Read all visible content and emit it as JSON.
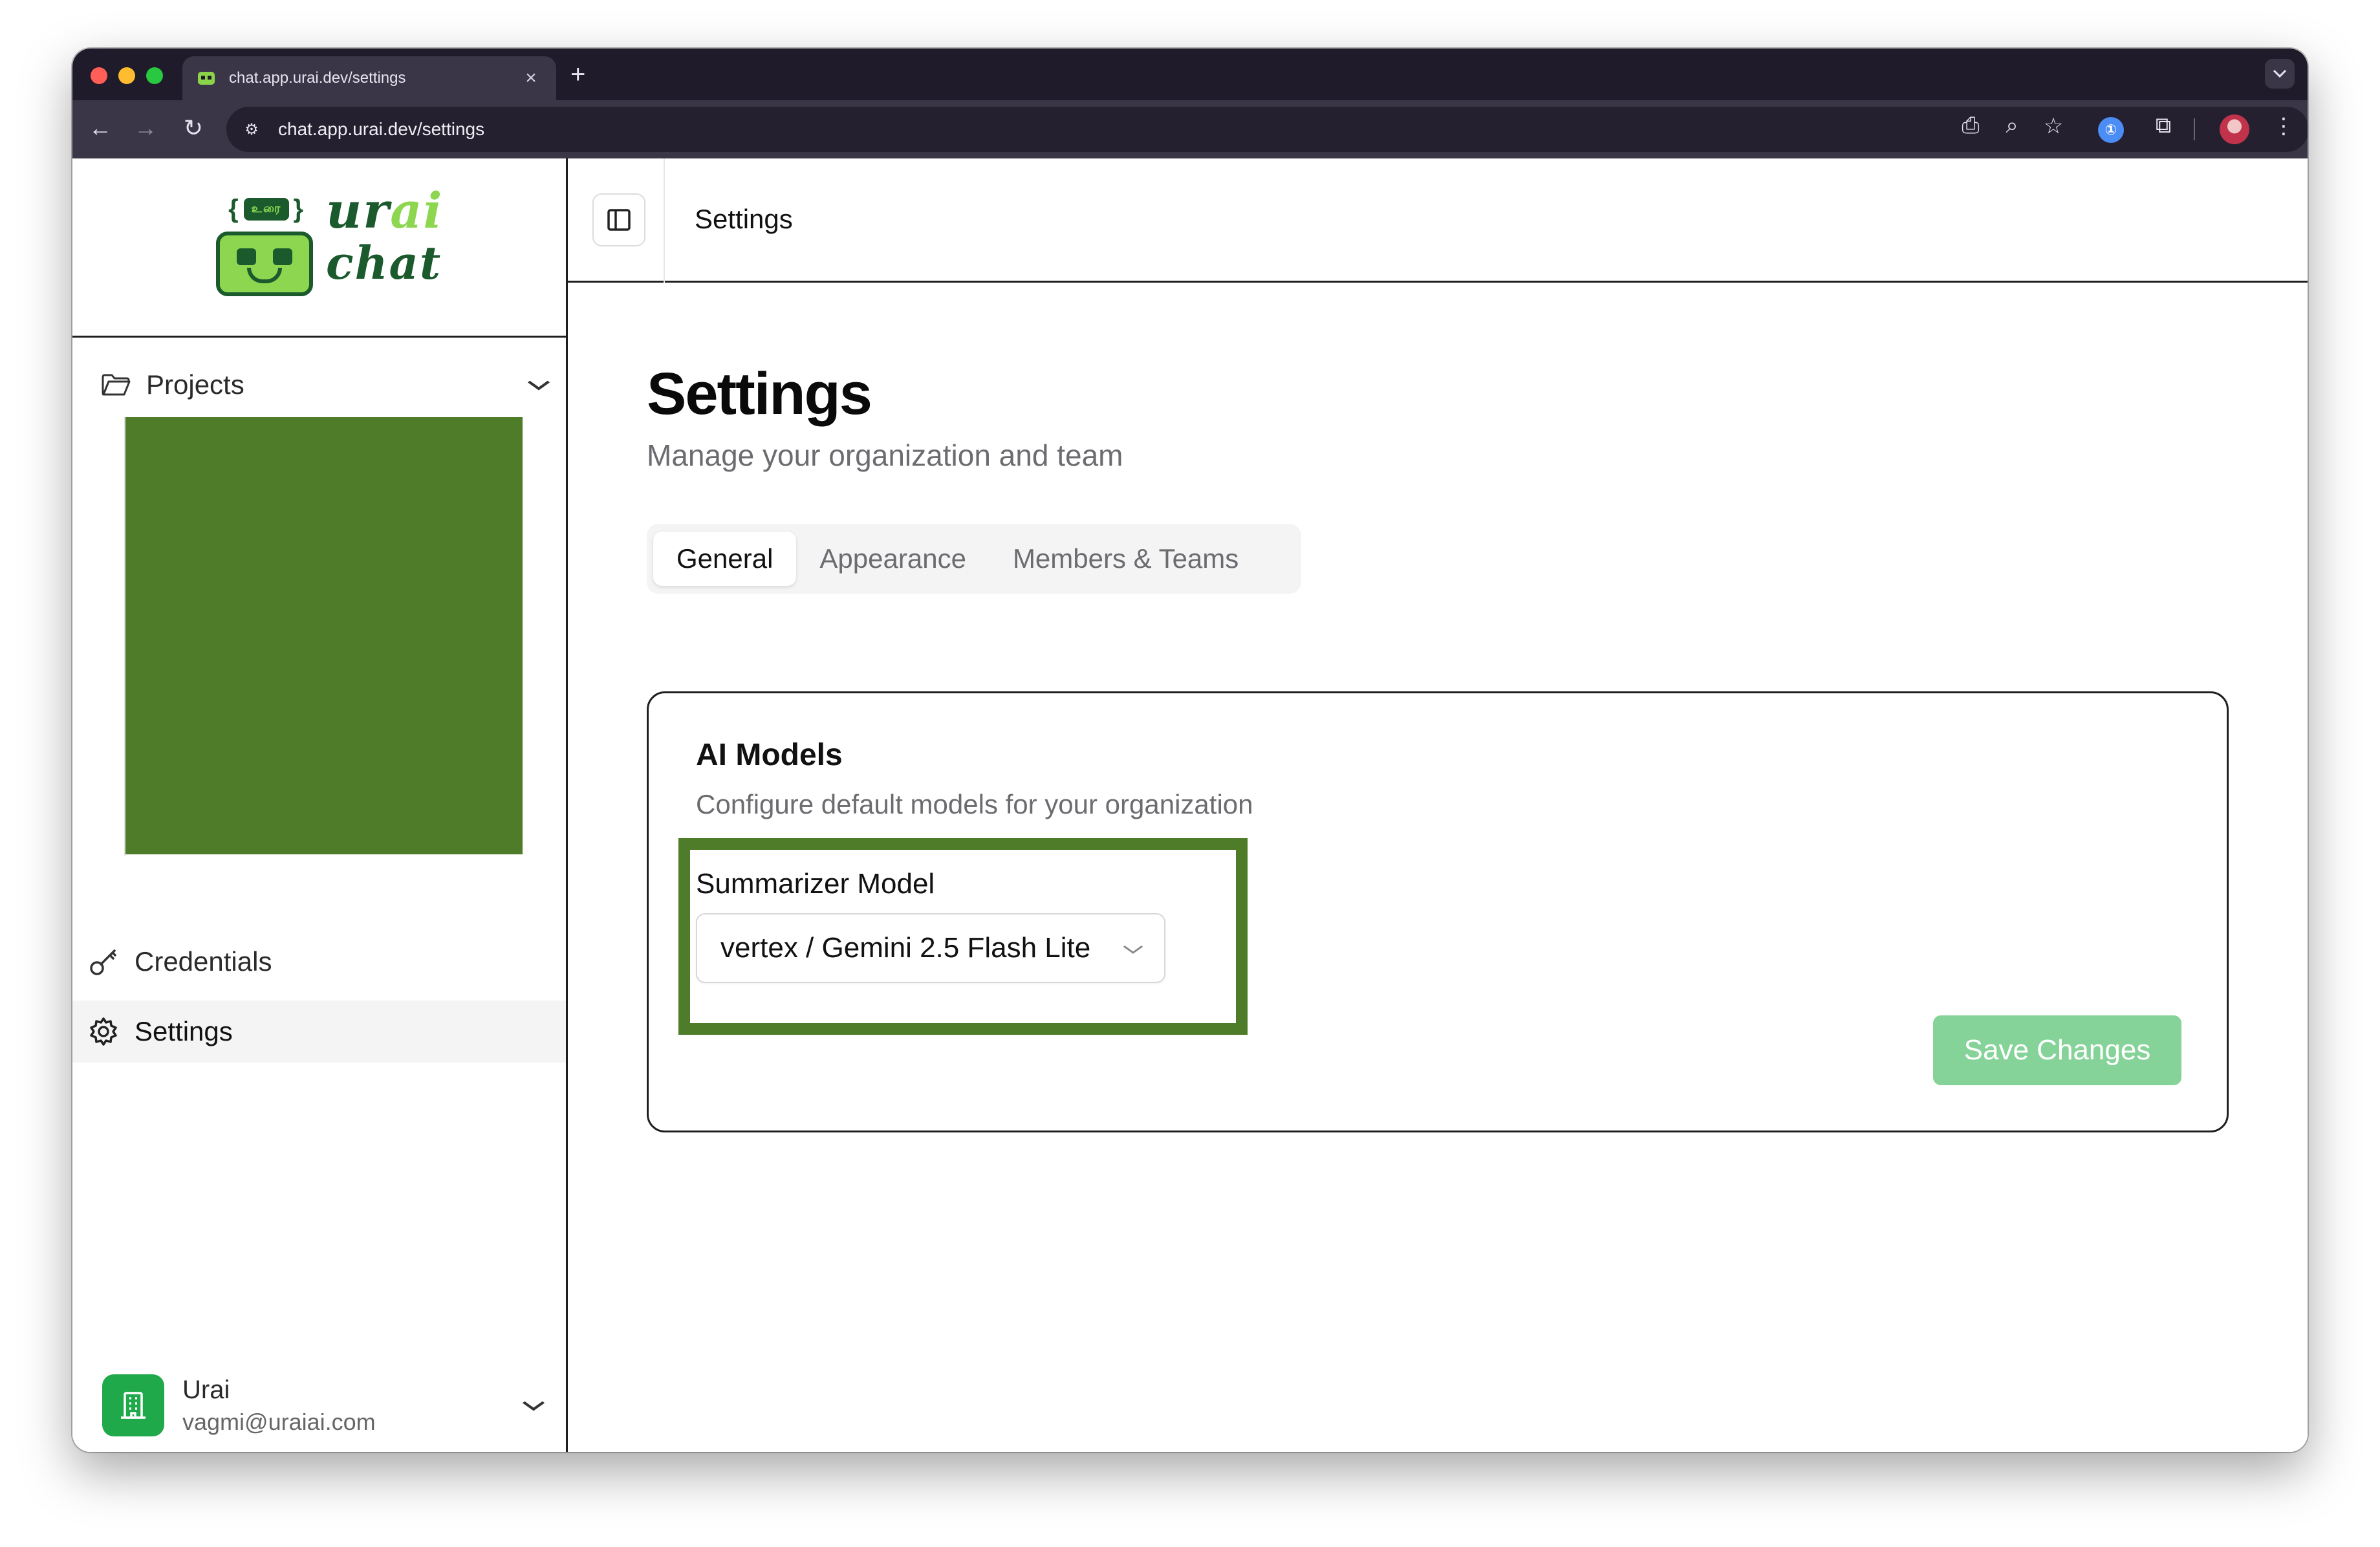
{
  "browser": {
    "tab_title": "chat.app.urai.dev/settings",
    "tab_close": "×",
    "new_tab": "+",
    "url": "chat.app.urai.dev/settings",
    "icons": [
      "back-icon",
      "forward-icon",
      "reload-icon",
      "site-info-icon",
      "cast-icon",
      "zoom-icon",
      "star-icon",
      "password-manager-icon",
      "extensions-icon",
      "profile-avatar",
      "menu-icon"
    ]
  },
  "sidebar": {
    "logo": {
      "bubble_text": "உரை",
      "word1_a": "ur",
      "word1_b": "ai",
      "word2": "chat"
    },
    "projects_label": "Projects",
    "items": [
      {
        "label": "Credentials",
        "icon": "key-icon"
      },
      {
        "label": "Settings",
        "icon": "gear-icon",
        "active": true
      }
    ],
    "user": {
      "name": "Urai",
      "email": "vagmi@uraiai.com"
    }
  },
  "header": {
    "title": "Settings"
  },
  "page": {
    "title": "Settings",
    "subtitle": "Manage your organization and team",
    "tabs": [
      {
        "label": "General",
        "active": true
      },
      {
        "label": "Appearance",
        "active": false
      },
      {
        "label": "Members & Teams",
        "active": false
      }
    ],
    "card": {
      "title": "AI Models",
      "description": "Configure default models for your organization",
      "field_label": "Summarizer Model",
      "select_value": "vertex / Gemini 2.5 Flash Lite",
      "save_label": "Save Changes"
    }
  },
  "colors": {
    "accent_green": "#4e7c28",
    "save_button_disabled": "#86d39a",
    "user_avatar": "#1fa94a"
  }
}
